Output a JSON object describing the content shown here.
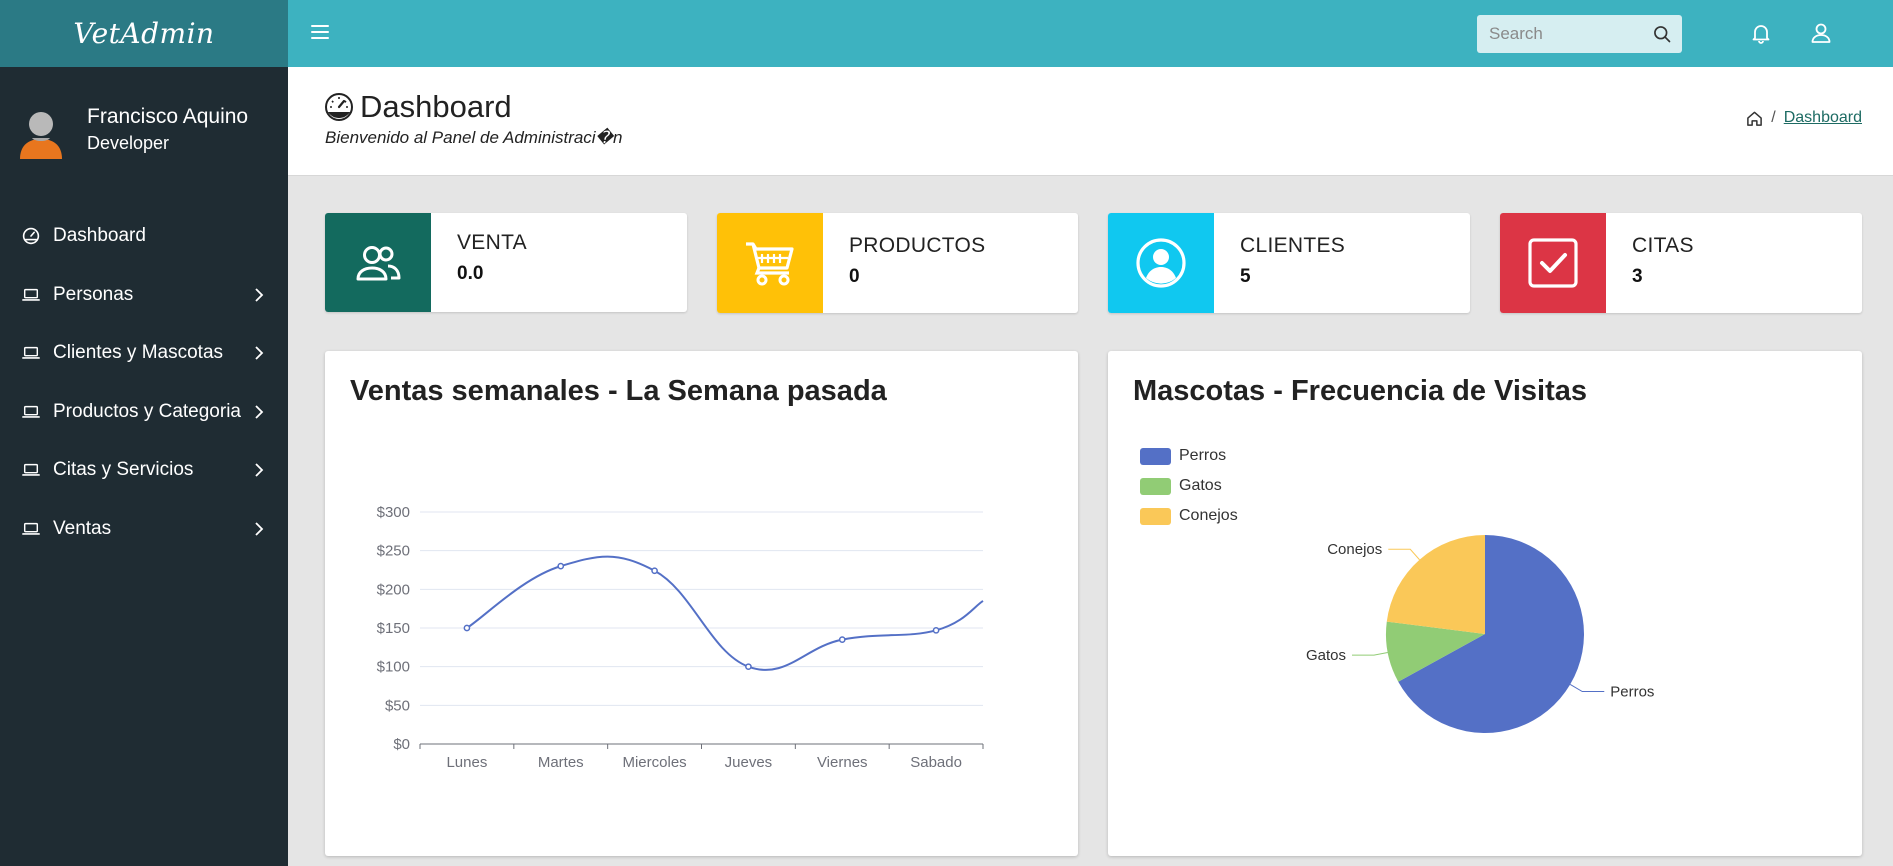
{
  "app": {
    "brand": "VetAdmin"
  },
  "topbar": {
    "search_placeholder": "Search"
  },
  "user": {
    "name": "Francisco Aquino",
    "role": "Developer"
  },
  "sidebar": {
    "items": [
      {
        "label": "Dashboard",
        "icon": "dashboard-icon",
        "has_submenu": false
      },
      {
        "label": "Personas",
        "icon": "laptop-icon",
        "has_submenu": true
      },
      {
        "label": "Clientes y Mascotas",
        "icon": "laptop-icon",
        "has_submenu": true
      },
      {
        "label": "Productos y Categoria",
        "icon": "laptop-icon",
        "has_submenu": true
      },
      {
        "label": "Citas y Servicios",
        "icon": "laptop-icon",
        "has_submenu": true
      },
      {
        "label": "Ventas",
        "icon": "laptop-icon",
        "has_submenu": true
      }
    ]
  },
  "header": {
    "title": "Dashboard",
    "subtitle": "Bienvenido al Panel de Administraci�n",
    "breadcrumb_current": "Dashboard"
  },
  "stats": [
    {
      "label": "VENTA",
      "value": "0.0",
      "color": "#136a5e",
      "icon": "users-icon"
    },
    {
      "label": "PRODUCTOS",
      "value": "0",
      "color": "#ffc107",
      "icon": "cart-icon"
    },
    {
      "label": "CLIENTES",
      "value": "5",
      "color": "#10c8f0",
      "icon": "user-circle-icon"
    },
    {
      "label": "CITAS",
      "value": "3",
      "color": "#dc3545",
      "icon": "check-square-icon"
    }
  ],
  "colors": {
    "topbar": "#3db2c0",
    "brand_bg": "#2b7a85",
    "sidebar": "#1f2c33",
    "line": "#5470c6"
  },
  "line_panel": {
    "title": "Ventas semanales - La Semana pasada"
  },
  "pie_panel": {
    "title": "Mascotas - Frecuencia de Visitas"
  },
  "chart_data": [
    {
      "type": "line",
      "title": "Ventas semanales - La Semana pasada",
      "categories": [
        "Lunes",
        "Martes",
        "Miercoles",
        "Jueves",
        "Viernes",
        "Sabado"
      ],
      "series": [
        {
          "values": [
            150,
            230,
            224,
            100,
            135,
            147,
            185
          ]
        }
      ],
      "y_ticks": [
        "$0",
        "$50",
        "$100",
        "$150",
        "$200",
        "$250",
        "$300"
      ],
      "ylim": [
        0,
        300
      ],
      "grid": true,
      "smooth": true
    },
    {
      "type": "pie",
      "title": "Mascotas - Frecuencia de Visitas",
      "slices": [
        {
          "name": "Perros",
          "value": 67,
          "color": "#5470c6"
        },
        {
          "name": "Gatos",
          "value": 10,
          "color": "#91cc75"
        },
        {
          "name": "Conejos",
          "value": 23,
          "color": "#fac858"
        }
      ],
      "legend": "top-left"
    }
  ]
}
